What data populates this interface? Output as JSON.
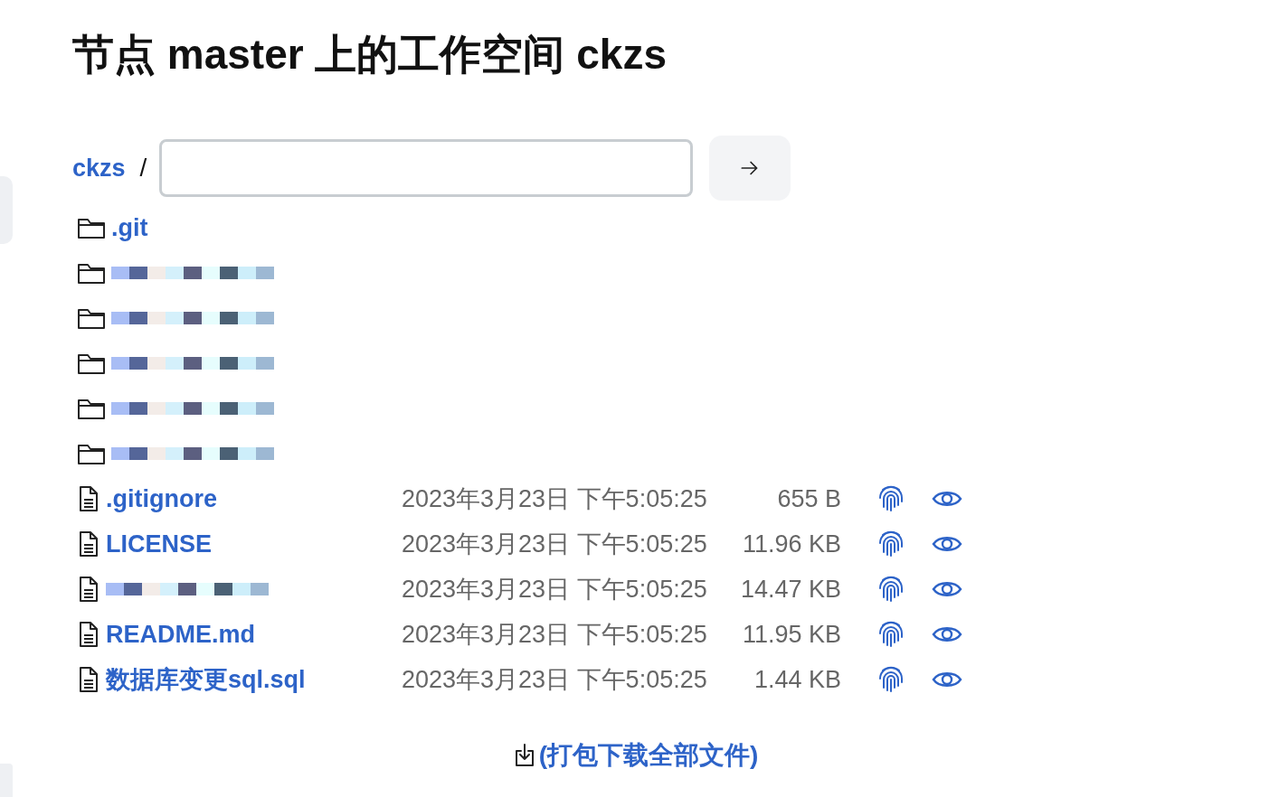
{
  "title": "节点 master 上的工作空间 ckzs",
  "breadcrumb": {
    "root": "ckzs",
    "separator": "/"
  },
  "entries": [
    {
      "kind": "folder",
      "name": ".git",
      "redacted": false
    },
    {
      "kind": "folder",
      "redacted": true
    },
    {
      "kind": "folder",
      "redacted": true
    },
    {
      "kind": "folder",
      "redacted": true
    },
    {
      "kind": "folder",
      "redacted": true
    },
    {
      "kind": "folder",
      "redacted": true
    },
    {
      "kind": "file",
      "name": ".gitignore",
      "redacted": false,
      "date": "2023年3月23日 下午5:05:25",
      "size": "655 B"
    },
    {
      "kind": "file",
      "name": "LICENSE",
      "redacted": false,
      "date": "2023年3月23日 下午5:05:25",
      "size": "11.96 KB"
    },
    {
      "kind": "file",
      "redacted": true,
      "date": "2023年3月23日 下午5:05:25",
      "size": "14.47 KB"
    },
    {
      "kind": "file",
      "name": "README.md",
      "redacted": false,
      "date": "2023年3月23日 下午5:05:25",
      "size": "11.95 KB"
    },
    {
      "kind": "file",
      "name": "数据库变更sql.sql",
      "redacted": false,
      "date": "2023年3月23日 下午5:05:25",
      "size": "1.44 KB"
    }
  ],
  "download": "(打包下载全部文件)"
}
